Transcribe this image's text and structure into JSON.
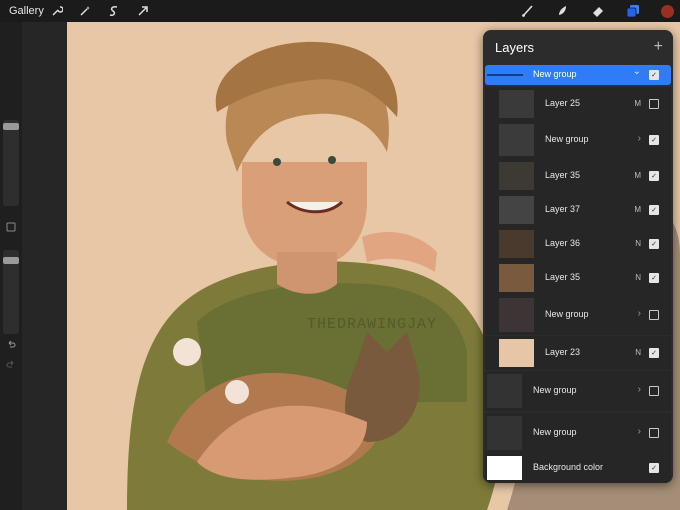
{
  "topbar": {
    "gallery_label": "Gallery",
    "left_tools": [
      "wrench-icon",
      "magic-wand-icon",
      "selection-icon",
      "transform-arrow-icon"
    ],
    "right_tools": [
      "brush-icon",
      "smudge-icon",
      "eraser-icon",
      "layers-icon"
    ],
    "color_swatch": "#9b2e22"
  },
  "canvas": {
    "watermark": "THEDRAWINGJAY"
  },
  "layers_panel": {
    "title": "Layers",
    "rows": [
      {
        "label": "New group",
        "mode": "",
        "group": true,
        "checked": true,
        "selected": true,
        "thumb": "#1b5dc7"
      },
      {
        "label": "Layer 25",
        "mode": "M",
        "group": false,
        "checked": false,
        "thumb": "#3a3a3a"
      },
      {
        "label": "New group",
        "mode": "",
        "group": true,
        "checked": true,
        "thumb": "#3b3b3b"
      },
      {
        "label": "Layer 35",
        "mode": "M",
        "group": false,
        "checked": true,
        "thumb": "#3d3a33"
      },
      {
        "label": "Layer 37",
        "mode": "M",
        "group": false,
        "checked": true,
        "thumb": "#444444"
      },
      {
        "label": "Layer 36",
        "mode": "N",
        "group": false,
        "checked": true,
        "thumb": "#4a3a2e"
      },
      {
        "label": "Layer 35",
        "mode": "N",
        "group": false,
        "checked": true,
        "thumb": "#7a5a3e"
      },
      {
        "label": "New group",
        "mode": "",
        "group": true,
        "checked": false,
        "thumb": "#3d3535"
      },
      {
        "label": "Layer 23",
        "mode": "N",
        "group": false,
        "checked": true,
        "thumb": "#e6c6a6"
      },
      {
        "label": "New group",
        "mode": "",
        "group": true,
        "checked": false,
        "thumb": "#333333"
      },
      {
        "label": "New group",
        "mode": "",
        "group": true,
        "checked": false,
        "thumb": "#333333"
      },
      {
        "label": "Background color",
        "mode": "",
        "group": false,
        "checked": true,
        "thumb": "#ffffff"
      }
    ]
  }
}
